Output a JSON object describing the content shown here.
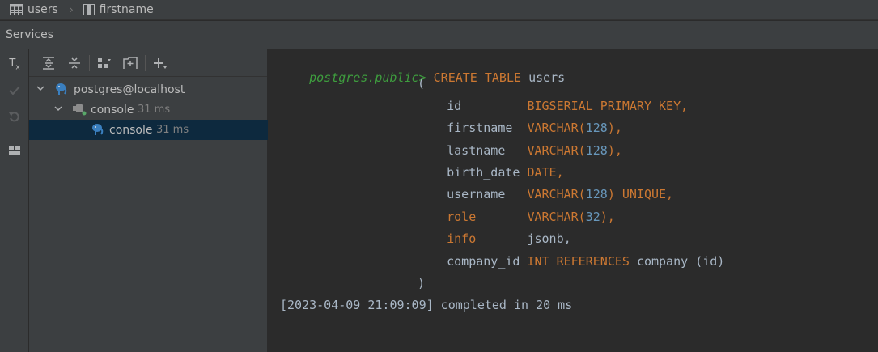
{
  "breadcrumb": {
    "items": [
      {
        "label": "users",
        "icon": "table-icon"
      },
      {
        "label": "firstname",
        "icon": "column-icon"
      }
    ]
  },
  "services": {
    "title": "Services"
  },
  "tree": {
    "rows": [
      {
        "label": "postgres@localhost",
        "meta": ""
      },
      {
        "label": "console",
        "meta": "31 ms"
      },
      {
        "label": "console",
        "meta": "31 ms"
      }
    ]
  },
  "editor": {
    "prompt": "postgres.public>",
    "lines": [
      {
        "t": [
          {
            "c": "kw",
            "v": "CREATE TABLE "
          },
          {
            "c": "plain",
            "v": "users"
          }
        ]
      },
      {
        "t": [
          {
            "c": "plain",
            "v": "("
          }
        ]
      },
      {
        "t": [
          {
            "c": "plain",
            "v": "    id         "
          },
          {
            "c": "kw",
            "v": "BIGSERIAL PRIMARY KEY,"
          }
        ]
      },
      {
        "t": [
          {
            "c": "plain",
            "v": "    firstname  "
          },
          {
            "c": "kw",
            "v": "VARCHAR("
          },
          {
            "c": "num",
            "v": "128"
          },
          {
            "c": "kw",
            "v": "),"
          }
        ]
      },
      {
        "t": [
          {
            "c": "plain",
            "v": "    lastname   "
          },
          {
            "c": "kw",
            "v": "VARCHAR("
          },
          {
            "c": "num",
            "v": "128"
          },
          {
            "c": "kw",
            "v": "),"
          }
        ]
      },
      {
        "t": [
          {
            "c": "plain",
            "v": "    birth_date "
          },
          {
            "c": "kw",
            "v": "DATE,"
          }
        ]
      },
      {
        "t": [
          {
            "c": "plain",
            "v": "    username   "
          },
          {
            "c": "kw",
            "v": "VARCHAR("
          },
          {
            "c": "num",
            "v": "128"
          },
          {
            "c": "kw",
            "v": ") UNIQUE,"
          }
        ]
      },
      {
        "t": [
          {
            "c": "plain",
            "v": "    "
          },
          {
            "c": "kw",
            "v": "role"
          },
          {
            "c": "plain",
            "v": "       "
          },
          {
            "c": "kw",
            "v": "VARCHAR("
          },
          {
            "c": "num",
            "v": "32"
          },
          {
            "c": "kw",
            "v": "),"
          }
        ]
      },
      {
        "t": [
          {
            "c": "plain",
            "v": "    "
          },
          {
            "c": "kw",
            "v": "info"
          },
          {
            "c": "plain",
            "v": "       jsonb,"
          }
        ]
      },
      {
        "t": [
          {
            "c": "plain",
            "v": "    company_id "
          },
          {
            "c": "kw",
            "v": "INT REFERENCES "
          },
          {
            "c": "plain",
            "v": "company (id)"
          }
        ]
      },
      {
        "t": [
          {
            "c": "plain",
            "v": ")"
          }
        ]
      }
    ],
    "result": "[2023-04-09 21:09:09] completed in 20 ms"
  },
  "colors": {
    "keyword": "#cc7832",
    "number": "#6897bb",
    "plain": "#a9b7c6",
    "prompt": "#3e9d3e",
    "selection": "#0d293e"
  }
}
